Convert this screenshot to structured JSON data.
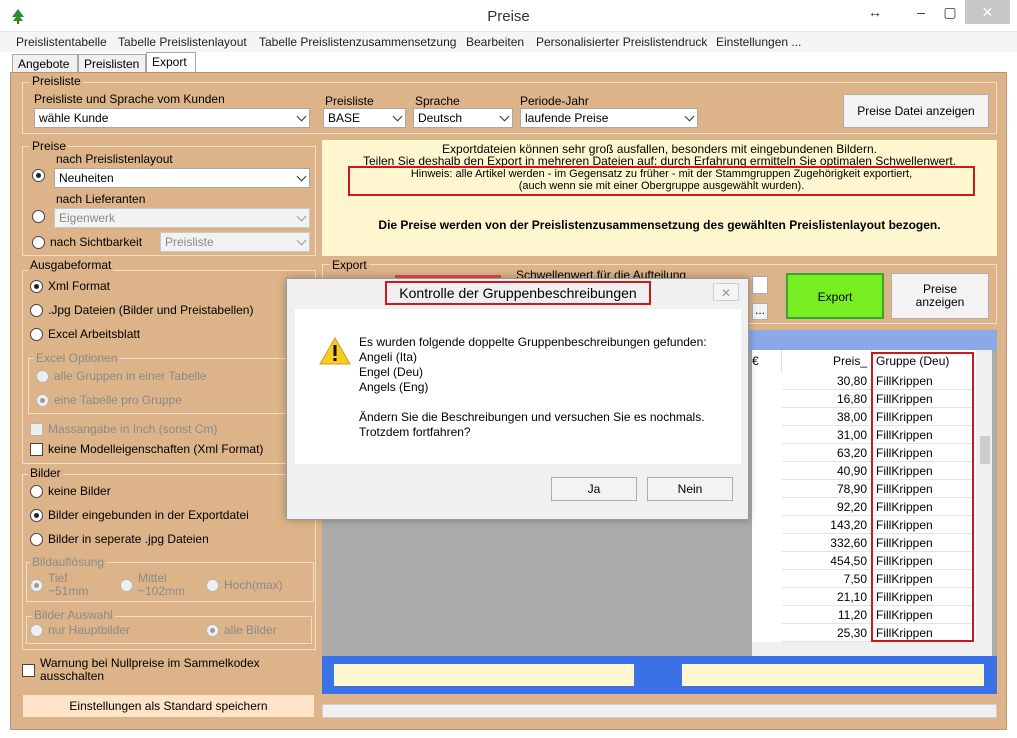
{
  "window": {
    "title": "Preise",
    "resize_glyph": "↔",
    "minimize_glyph": "–",
    "maximize_glyph": "▢",
    "close_glyph": "✕"
  },
  "menu": [
    "Preislistentabelle",
    "Tabelle Preislistenlayout",
    "Tabelle Preislistenzusammensetzung",
    "Bearbeiten",
    "Personalisierter Preislistendruck",
    "Einstellungen ..."
  ],
  "tabs": [
    "Angebote",
    "Preislisten",
    "Export"
  ],
  "preisliste": {
    "group_label": "Preisliste",
    "kunde_label": "Preisliste und Sprache vom Kunden",
    "kunde_value": "wähle Kunde",
    "preisliste_label": "Preisliste",
    "preisliste_value": "BASE",
    "sprache_label": "Sprache",
    "sprache_value": "Deutsch",
    "periode_label": "Periode-Jahr",
    "periode_value": "laufende Preise",
    "show_button": "Preise Datei anzeigen"
  },
  "preise": {
    "group_label": "Preise",
    "layout_label": "nach Preislistenlayout",
    "layout_value": "Neuheiten",
    "lieferanten_label": "nach Lieferanten",
    "lieferanten_value": "Eigenwerk",
    "sicht_label": "nach Sichtbarkeit",
    "sicht_value": "Preisliste"
  },
  "info": {
    "line1": "Exportdateien können sehr groß ausfallen, besonders mit eingebundenen Bildern.",
    "line2": "Teilen Sie deshalb den Export in mehreren Dateien auf: durch Erfahrung ermitteln Sie optimalen Schwellenwert.",
    "hint1": "Hinweis: alle Artikel werden - im Gegensatz zu früher - mit der Stammgruppen Zugehörigkeit exportiert,",
    "hint2": "(auch wenn sie mit einer Obergruppe ausgewählt wurden).",
    "bold": "Die Preise werden von der Preislistenzusammensetzung des gewählten Preislistenlayout bezogen."
  },
  "ausgabe": {
    "group_label": "Ausgabeformat",
    "xml": "Xml Format",
    "jpg": ".Jpg Dateien (Bilder und Preistabellen)",
    "excel": "Excel Arbeitsblatt",
    "excel_opt_label": "Excel Optionen",
    "alle_gruppen": "alle Gruppen in einer Tabelle",
    "pro_gruppe": "eine Tabelle pro Gruppe",
    "inch": "Massangabe in Inch (sonst Cm)",
    "modell": "keine Modelleigenschaften (Xml Format)"
  },
  "bilder": {
    "group_label": "Bilder",
    "keine": "keine Bilder",
    "eingebunden": "Bilder eingebunden in der Exportdatei",
    "seperat": "Bilder in seperate .jpg Dateien",
    "aufl_label": "Bildauflösung",
    "tief1": "Tief",
    "tief2": "~51mm",
    "mittel1": "Mittel",
    "mittel2": "~102mm",
    "hoch": "Hoch(max)",
    "auswahl_label": "Bilder Auswahl",
    "haupt": "nur Hauptbilder",
    "alle": "alle Bilder"
  },
  "warnung": {
    "line1": "Warnung bei Nullpreise im Sammelkodex",
    "line2": "ausschalten"
  },
  "save_button": "Einstellungen als Standard speichern",
  "export": {
    "group_label": "Export",
    "schwelle_label": "Schwellenwert für die Aufteilung",
    "export_button": "Export",
    "preise_btn1": "Preise",
    "preise_btn2": "anzeigen",
    "dots": "...",
    "accent": "#77ee22"
  },
  "table": {
    "col_partial": "€",
    "col_preis": "Preis_",
    "col_gruppe": "Gruppe (Deu)",
    "prices": [
      "30,80",
      "16,80",
      "38,00",
      "31,00",
      "63,20",
      "40,90",
      "78,90",
      "92,20",
      "143,20",
      "332,60",
      "454,50",
      "7,50",
      "21,10",
      "11,20",
      "25,30"
    ],
    "groups": [
      "FillKrippen",
      "FillKrippen",
      "FillKrippen",
      "FillKrippen",
      "FillKrippen",
      "FillKrippen",
      "FillKrippen",
      "FillKrippen",
      "FillKrippen",
      "FillKrippen",
      "FillKrippen",
      "FillKrippen",
      "FillKrippen",
      "FillKrippen",
      "FillKrippen"
    ]
  },
  "dialog": {
    "title": "Kontrolle der Gruppenbeschreibungen",
    "close": "✕",
    "msg1": "Es wurden folgende doppelte Gruppenbeschreibungen gefunden:",
    "msg2": "Angeli (Ita)",
    "msg3": "Engel (Deu)",
    "msg4": "Angels (Eng)",
    "msg5": "Ändern Sie die Beschreibungen und versuchen Sie es nochmals.",
    "msg6": "Trotzdem fortfahren?",
    "ja": "Ja",
    "nein": "Nein"
  }
}
